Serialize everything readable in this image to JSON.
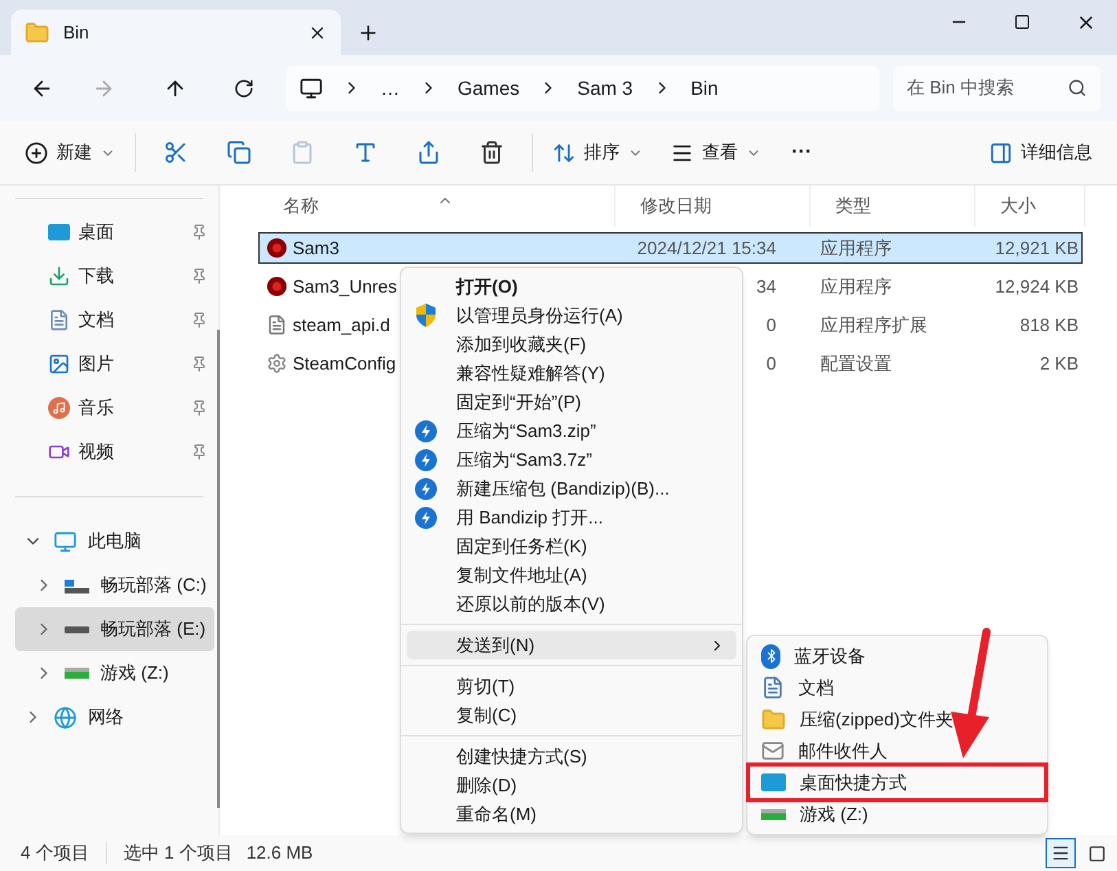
{
  "tab": {
    "title": "Bin"
  },
  "address": {
    "crumbs": [
      "…",
      "Games",
      "Sam 3",
      "Bin"
    ]
  },
  "search": {
    "placeholder": "在 Bin 中搜索"
  },
  "toolbar": {
    "new": "新建",
    "actions": [
      {
        "kind": "cut",
        "disabled": false
      },
      {
        "kind": "copy",
        "disabled": false
      },
      {
        "kind": "paste",
        "disabled": true
      },
      {
        "kind": "rename",
        "disabled": false
      },
      {
        "kind": "share",
        "disabled": false
      },
      {
        "kind": "delete",
        "disabled": false
      }
    ],
    "sort": "排序",
    "view": "查看",
    "more": "···",
    "details": "详细信息"
  },
  "sidebar": {
    "quick_access": [
      {
        "label": "桌面",
        "kind": "desktop"
      },
      {
        "label": "下载",
        "kind": "download"
      },
      {
        "label": "文档",
        "kind": "document"
      },
      {
        "label": "图片",
        "kind": "picture"
      },
      {
        "label": "音乐",
        "kind": "music"
      },
      {
        "label": "视频",
        "kind": "video"
      }
    ],
    "tree": [
      {
        "label": "此电脑",
        "kind": "pc",
        "expanded": true,
        "selected": false,
        "children": [
          {
            "label": "畅玩部落 (C:)",
            "kind": "system-drive",
            "expanded": false,
            "selected": false
          },
          {
            "label": "畅玩部落 (E:)",
            "kind": "drive",
            "expanded": false,
            "selected": true
          },
          {
            "label": "游戏 (Z:)",
            "kind": "green-drive",
            "expanded": false,
            "selected": false
          }
        ]
      },
      {
        "label": "网络",
        "kind": "network",
        "expanded": false,
        "selected": false
      }
    ]
  },
  "table": {
    "columns": [
      "名称",
      "修改日期",
      "类型",
      "大小"
    ],
    "rows": [
      {
        "name": "Sam3",
        "kind": "exe",
        "date": "2024/12/21 15:34",
        "type": "应用程序",
        "size": "12,921 KB",
        "selected": true
      },
      {
        "name": "Sam3_Unres",
        "kind": "exe",
        "date": "34",
        "type": "应用程序",
        "size": "12,924 KB",
        "selected": false
      },
      {
        "name": "steam_api.d",
        "kind": "dll",
        "date": "0",
        "type": "应用程序扩展",
        "size": "818 KB",
        "selected": false
      },
      {
        "name": "SteamConfig",
        "kind": "config",
        "date": "0",
        "type": "配置设置",
        "size": "2 KB",
        "selected": false
      }
    ]
  },
  "status_bar": {
    "count": "4 个项目",
    "selection": "选中 1 个项目",
    "size": "12.6 MB",
    "views": [
      {
        "kind": "details",
        "selected": true
      },
      {
        "kind": "tiles",
        "selected": false
      }
    ]
  },
  "context_menu": {
    "items": [
      {
        "kind": "default",
        "label": "打开(O)",
        "selected": false
      },
      {
        "kind": "shield",
        "label": "以管理员身份运行(A)",
        "selected": false
      },
      {
        "kind": "plain",
        "label": "添加到收藏夹(F)",
        "selected": false
      },
      {
        "kind": "plain",
        "label": "兼容性疑难解答(Y)",
        "selected": false
      },
      {
        "kind": "plain",
        "label": "固定到“开始”(P)",
        "selected": false
      },
      {
        "kind": "archive",
        "label": "压缩为“Sam3.zip”",
        "selected": false
      },
      {
        "kind": "archive",
        "label": "压缩为“Sam3.7z”",
        "selected": false
      },
      {
        "kind": "archive",
        "label": "新建压缩包 (Bandizip)(B)...",
        "selected": false
      },
      {
        "kind": "archive",
        "label": "用 Bandizip 打开...",
        "selected": false
      },
      {
        "kind": "plain",
        "label": "固定到任务栏(K)",
        "selected": false
      },
      {
        "kind": "plain",
        "label": "复制文件地址(A)",
        "selected": false
      },
      {
        "kind": "plain",
        "label": "还原以前的版本(V)",
        "selected": false
      },
      {
        "kind": "separator"
      },
      {
        "kind": "submenu",
        "label": "发送到(N)",
        "selected": true
      },
      {
        "kind": "separator"
      },
      {
        "kind": "plain",
        "label": "剪切(T)",
        "selected": false
      },
      {
        "kind": "plain",
        "label": "复制(C)",
        "selected": false
      },
      {
        "kind": "separator"
      },
      {
        "kind": "plain",
        "label": "创建快捷方式(S)",
        "selected": false
      },
      {
        "kind": "plain",
        "label": "删除(D)",
        "selected": false
      },
      {
        "kind": "plain",
        "label": "重命名(M)",
        "selected": false
      }
    ]
  },
  "send_to_menu": {
    "items": [
      {
        "kind": "bluetooth",
        "label": "蓝牙设备",
        "highlighted": false
      },
      {
        "kind": "document",
        "label": "文档",
        "highlighted": false
      },
      {
        "kind": "zip-folder",
        "label": "压缩(zipped)文件夹",
        "highlighted": false
      },
      {
        "kind": "mail",
        "label": "邮件收件人",
        "highlighted": false
      },
      {
        "kind": "desktop",
        "label": "桌面快捷方式",
        "highlighted": true
      },
      {
        "kind": "green-drive",
        "label": "游戏 (Z:)",
        "highlighted": false
      }
    ]
  }
}
